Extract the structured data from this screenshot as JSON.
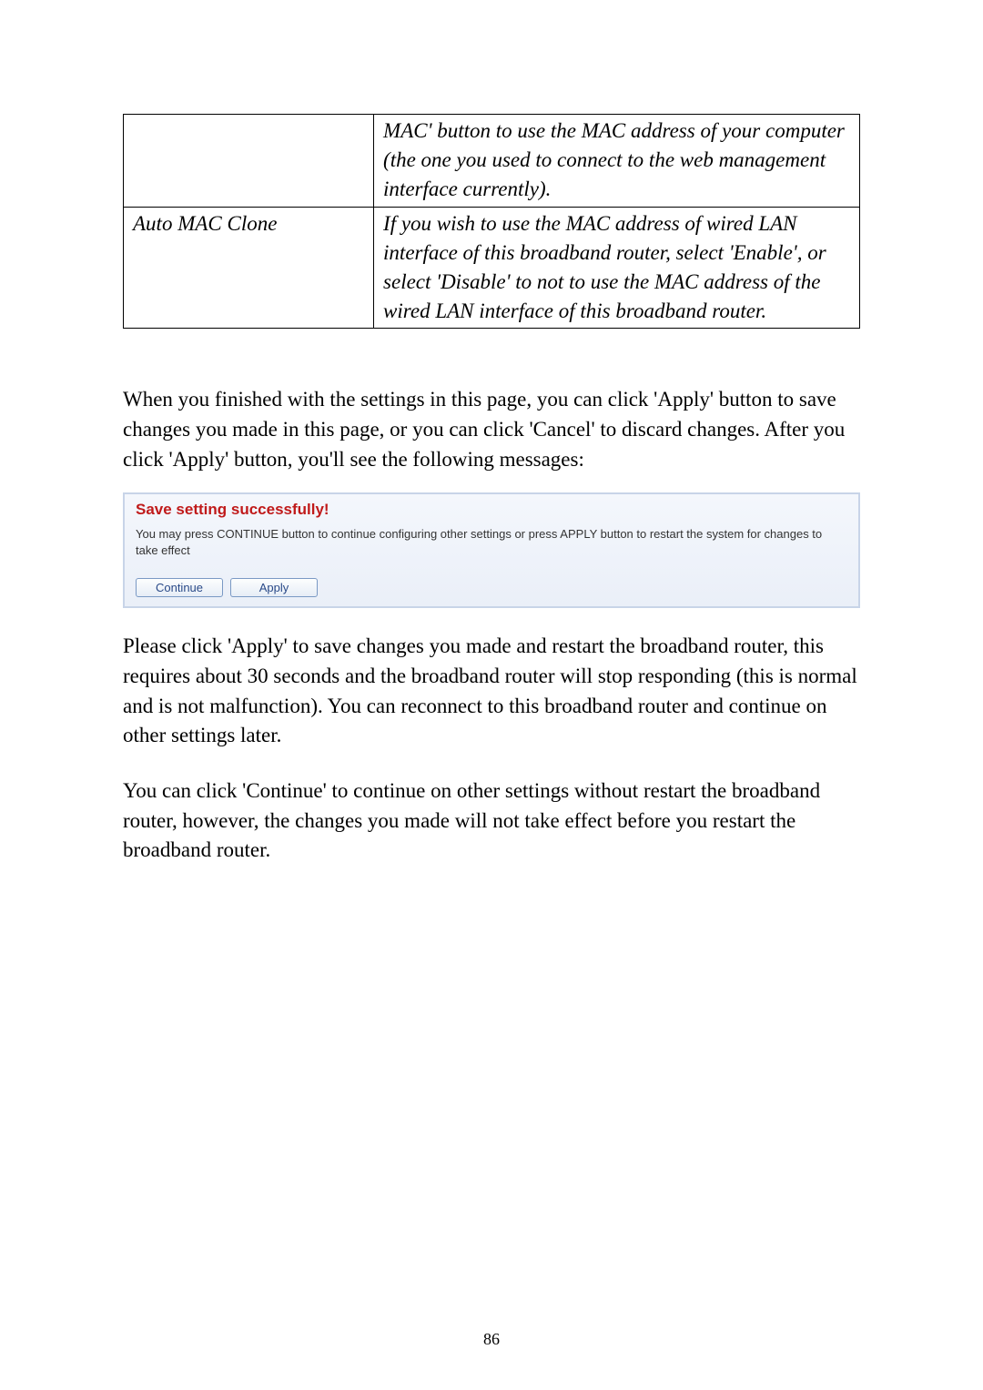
{
  "table": {
    "row1": {
      "col1": "",
      "col2": "MAC' button to use the MAC address of your computer (the one you used to connect to the web management interface currently)."
    },
    "row2": {
      "col1": "Auto MAC Clone",
      "col2": "If you wish to use the MAC address of wired LAN interface of this broadband router, select 'Enable', or select 'Disable' to not to use the MAC address of the wired LAN interface of this broadband router."
    }
  },
  "para1": "When you finished with the settings in this page, you can click 'Apply' button to save changes you made in this page, or you can click 'Cancel' to discard changes. After you click 'Apply' button, you'll see the following messages:",
  "panel": {
    "title": "Save setting successfully!",
    "message": "You may press CONTINUE button to continue configuring other settings or press APPLY button to restart the system for changes to take effect",
    "continueLabel": "Continue",
    "applyLabel": "Apply"
  },
  "para2": "Please click 'Apply' to save changes you made and restart the broadband router, this requires about 30 seconds and the broadband router will stop responding (this is normal and is not malfunction). You can reconnect to this broadband router and continue on other settings later.",
  "para3": "You can click 'Continue' to continue on other settings without restart the broadband router, however, the changes you made will not take effect before you restart the broadband router.",
  "pageNumber": "86"
}
